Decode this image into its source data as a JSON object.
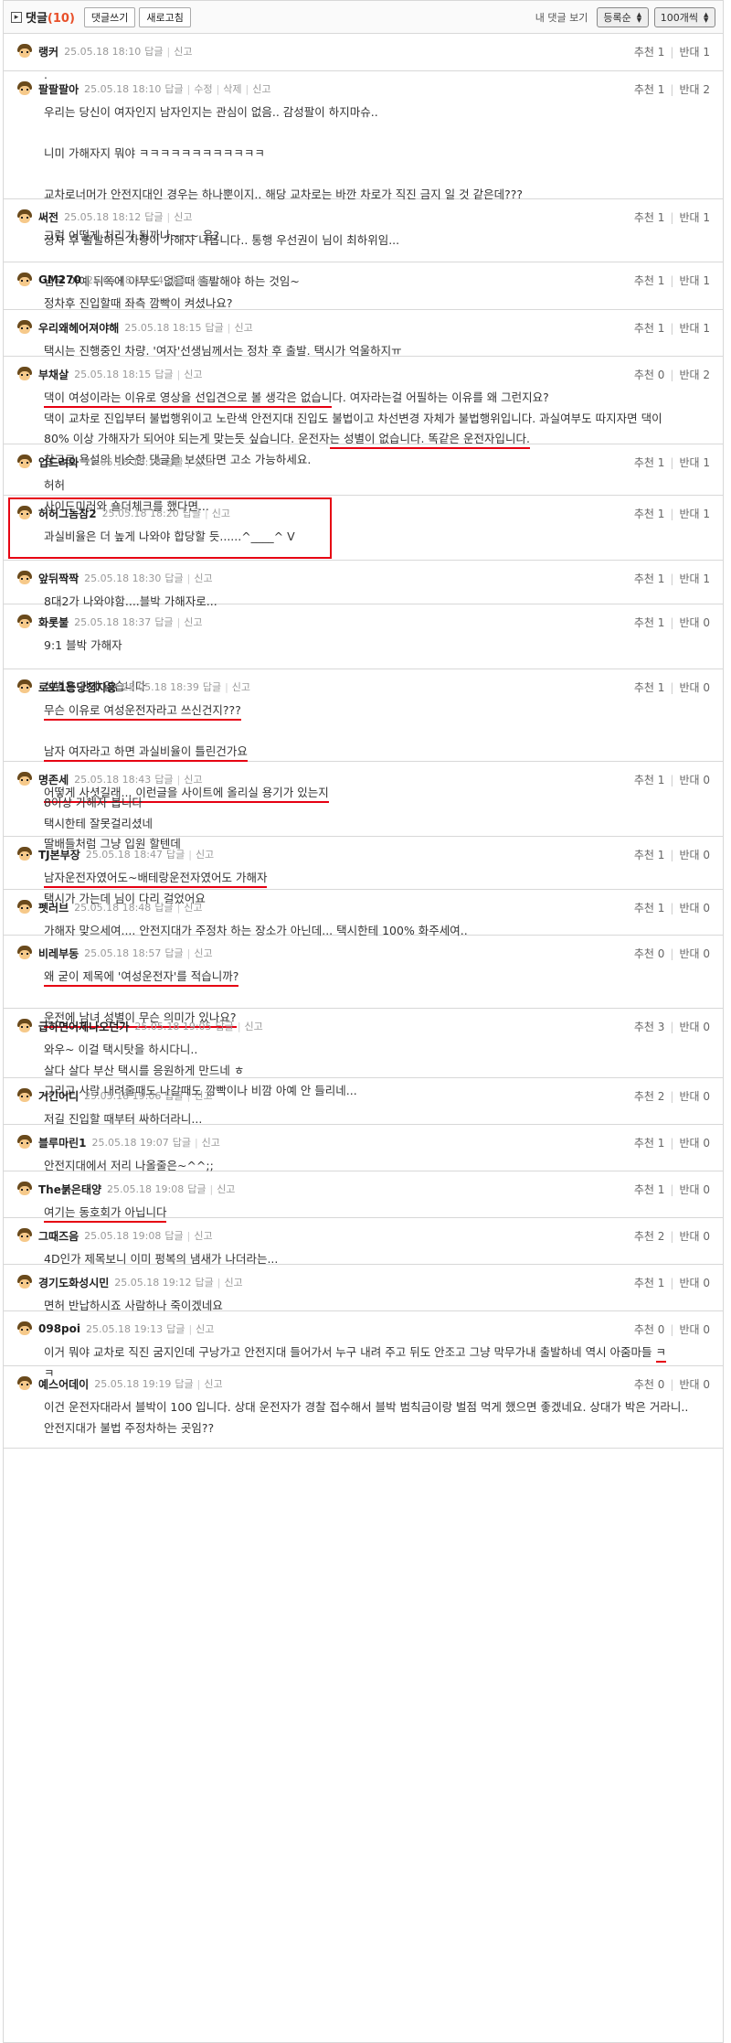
{
  "toolbar": {
    "title": "댓글",
    "count": "(10)",
    "write_label": "댓글쓰기",
    "refresh_label": "새로고침",
    "mine_label": "내 댓글 보기",
    "sort_value": "등록순",
    "per_page_value": "100개씩"
  },
  "labels": {
    "reply": "답글",
    "report": "신고",
    "edit": "수정",
    "delete": "삭제",
    "up": "추천",
    "down": "반대"
  },
  "colors": {
    "accent": "#e8502a",
    "highlight": "#e60012",
    "border": "#d8d8d8"
  },
  "comments": [
    {
      "author": "랭커",
      "date": "25.05.18 18:10",
      "up": 1,
      "down": 1,
      "lines": [
        "."
      ]
    },
    {
      "author": "팔팔팔아",
      "date": "25.05.18 18:10",
      "up": 1,
      "down": 2,
      "editable": true,
      "lines": [
        "우리는 당신이 여자인지 남자인지는 관심이 없음.. 감성팔이 하지마슈..",
        "",
        "니미 가해자지 뭐야 ㅋㅋㅋㅋㅋㅋㅋㅋㅋㅋㅋㅋ",
        "",
        "교차로너머가 안전지대인 경우는 하나뿐이지.. 해당 교차로는 바깐 차로가 직진 금지 일 것 같은데???",
        "",
        "그럼 어떻게 처리가 될까나~~~ 응?"
      ]
    },
    {
      "author": "써전",
      "date": "25.05.18 18:12",
      "up": 1,
      "down": 1,
      "lines": [
        "정차 후 출발하는 차량이 가해자 나옵니다.. 통행 우선권이 님이 최하위임...",
        "",
        "님은 아예 뒤쪽에 아무도 없을때 출발해야 하는 것임~"
      ]
    },
    {
      "author": "GM270",
      "date": "25.05.18 18:14",
      "up": 1,
      "down": 1,
      "lines": [
        "정차후 진입할때 좌측 깜빡이 켜셨나요?"
      ]
    },
    {
      "author": "우리왜헤어져야해",
      "date": "25.05.18 18:15",
      "up": 1,
      "down": 1,
      "lines": [
        "택시는 진행중인 차량. '여자'선생님께서는 정차 후 출발. 택시가 억울하지ㅠ"
      ]
    },
    {
      "author": "부채살",
      "date": "25.05.18 18:15",
      "up": 0,
      "down": 2,
      "lines": [
        "댁이 여성이라는 이유로 영상을 선입견으로 볼 생각은 없습니다. 여자라는걸 어필하는 이유를 왜 그런지요?",
        "댁이 교차로 진입부터 불법행위이고 노란색 안전지대 진입도 불법이고 차선변경 자체가 불법행위입니다. 과실여부도 따지자면 댁이",
        "80% 이상 가해자가 되어야 되는게 맞는듯 싶습니다. 운전자는 성별이 없습니다. 똑같은 운전자입니다.",
        "참고로 욕설의 비슷한 댓글을 보셨다면 고소 가능하세요."
      ]
    },
    {
      "author": "업드려와",
      "date": "25.05.18 18:18",
      "up": 1,
      "down": 1,
      "lines": [
        "허허",
        "사이드미러와 숄더체크를 했다면..."
      ]
    },
    {
      "author": "허허그놈참2",
      "date": "25.05.18 18:20",
      "up": 1,
      "down": 1,
      "lines": [
        "과실비율은 더 높게 나와야 합당할 듯......^____^ V"
      ]
    },
    {
      "author": "앞뒤짝짝",
      "date": "25.05.18 18:30",
      "up": 1,
      "down": 1,
      "lines": [
        "8대2가 나와야함....블박 가해자로..."
      ]
    },
    {
      "author": "화롯불",
      "date": "25.05.18 18:37",
      "up": 1,
      "down": 0,
      "lines": [
        "9:1 블박 가해자",
        "",
        "성별은 관계 없습니다"
      ]
    },
    {
      "author": "로또1등당첨자용",
      "date": "25.05.18 18:39",
      "up": 1,
      "down": 0,
      "lines": [
        "무슨 이유로 여성운전자라고 쓰신건지???",
        "",
        "남자 여자라고 하면 과실비율이 틀린건가요",
        "",
        "어떻게 사셧길래... 이런글을 사이트에 올리실 용기가 있는지"
      ]
    },
    {
      "author": "명존세",
      "date": "25.05.18 18:43",
      "up": 1,
      "down": 0,
      "lines": [
        "8이상 가해자 봅니다",
        "택시한테 잘못걸리셨네",
        "딸배들처럼 그냥 입원 할텐데"
      ]
    },
    {
      "author": "TJ본부장",
      "date": "25.05.18 18:47",
      "up": 1,
      "down": 0,
      "lines": [
        "남자운전자였어도~배테랑운전자였어도 가해자",
        "택시가 가는데 님이 다리 걸었어요"
      ]
    },
    {
      "author": "펫러브",
      "date": "25.05.18 18:48",
      "up": 1,
      "down": 0,
      "lines": [
        "가해자 맞으세여.... 안전지대가 주정차 하는 장소가 아닌데... 택시한테 100% 화주세여.."
      ]
    },
    {
      "author": "비레부동",
      "date": "25.05.18 18:57",
      "up": 0,
      "down": 0,
      "lines": [
        "왜 굳이 제목에 '여성운전자'를 적습니까?",
        "",
        "운전에 남녀 성별이 무슨 의미가 있나요?"
      ]
    },
    {
      "author": "급하면어제나오던가",
      "date": "25.05.18 19:05",
      "up": 3,
      "down": 0,
      "lines": [
        "와우~ 이걸 택시탓을 하시다니..",
        "살다 살다 부산 택시를 응원하게 만드네 ㅎ",
        "그리고 사람 내려줄때도 나갈때도 깜빡이나 비깜 아예 안 들리네..."
      ]
    },
    {
      "author": "거긴어디",
      "date": "25.05.18 19:06",
      "up": 2,
      "down": 0,
      "lines": [
        "저길 진입할 때부터 싸하더라니..."
      ]
    },
    {
      "author": "블루마린1",
      "date": "25.05.18 19:07",
      "up": 1,
      "down": 0,
      "lines": [
        "안전지대에서 저리 나올줄은~^^;;"
      ]
    },
    {
      "author": "The붉은태양",
      "date": "25.05.18 19:08",
      "up": 1,
      "down": 0,
      "lines": [
        "여기는 동호회가 아닙니다"
      ]
    },
    {
      "author": "그때즈음",
      "date": "25.05.18 19:08",
      "up": 2,
      "down": 0,
      "lines": [
        "4D인가 제목보니 이미 펑복의 냄새가 나더라는..."
      ]
    },
    {
      "author": "경기도화성시민",
      "date": "25.05.18 19:12",
      "up": 1,
      "down": 0,
      "lines": [
        "면허 반납하시죠 사람하나 죽이겠네요"
      ]
    },
    {
      "author": "098poi",
      "date": "25.05.18 19:13",
      "up": 0,
      "down": 0,
      "lines": [
        "이거 뭐야 교차로 직진 굼지인데 구낭가고 안전지대 들어가서 누구 내려 주고 뒤도 안조고 그냥 막무가내 출발하네 역시 아줌마들 ㅋ",
        "ㅋ"
      ]
    },
    {
      "author": "예스어데이",
      "date": "25.05.18 19:19",
      "up": 0,
      "down": 0,
      "lines": [
        "이건 운전자대라서 블박이 100 입니다. 상대 운전자가 경찰 접수해서 블박 범칙금이랑 벌점 먹게 했으면 좋겠네요. 상대가 박은 거라니..",
        "안전지대가 불법 주정차하는 곳임??"
      ]
    }
  ]
}
